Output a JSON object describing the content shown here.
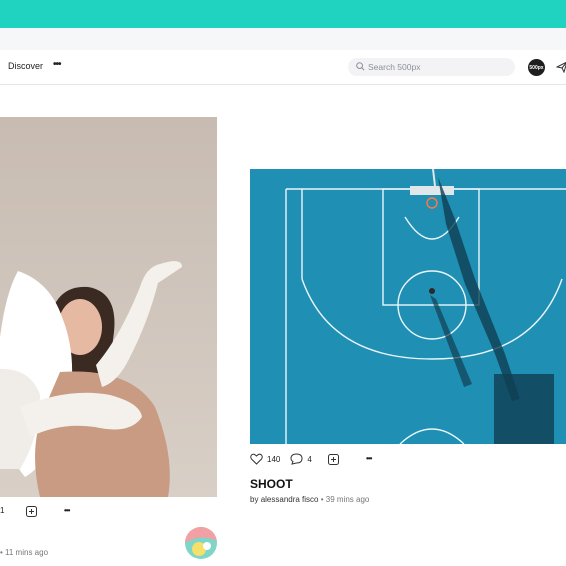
{
  "colors": {
    "brand_bar": "#1fd3c0",
    "court_blue": "#1f8fb3"
  },
  "nav": {
    "discover_label": "Discover",
    "more_label": "•••",
    "search_placeholder": "Search 500px",
    "avatar_text": "500px"
  },
  "photos": [
    {
      "stats": {
        "comments": "1"
      },
      "byline_time": "• 11 mins ago"
    },
    {
      "title": "SHOOT",
      "stats": {
        "likes": "140",
        "comments": "4"
      },
      "author_prefix": "by",
      "author": "alessandra fisco",
      "time": "• 39 mins ago"
    }
  ],
  "more_options_label": "•••"
}
